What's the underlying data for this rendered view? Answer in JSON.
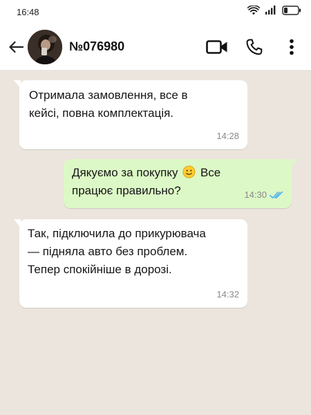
{
  "status_bar": {
    "time": "16:48"
  },
  "header": {
    "contact_name": "№076980"
  },
  "messages": [
    {
      "direction": "incoming",
      "lines": [
        "Отримала замовлення, все в",
        "кейсі, повна комплектація."
      ],
      "time": "14:28"
    },
    {
      "direction": "outgoing",
      "line1_before_emoji": "Дякуємо за покупку",
      "emoji": "slightly-smiling-face",
      "line1_after_emoji": "Все",
      "line2": "працює правильно?",
      "time": "14:30",
      "read_receipt": "double-check-read"
    },
    {
      "direction": "incoming",
      "lines": [
        "Так, підключила до прикурювача",
        "— підняла авто без проблем.",
        "Тепер спокійніше в дорозі."
      ],
      "time": "14:32"
    }
  ],
  "colors": {
    "background": "#ece5dd",
    "incoming_bubble": "#ffffff",
    "outgoing_bubble": "#dcf8c6",
    "read_ticks": "#4fb6ec"
  }
}
